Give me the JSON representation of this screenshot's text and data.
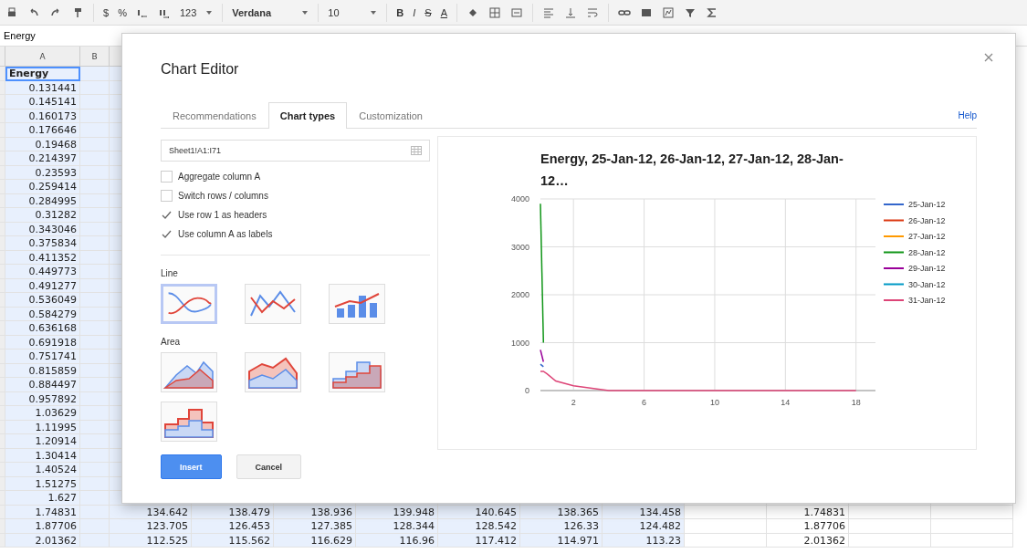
{
  "toolbar": {
    "currency": "$",
    "percent": "%",
    "number_format": "123",
    "font": "Verdana",
    "font_size": "10",
    "bold": "B",
    "italic": "I",
    "strikethrough": "S",
    "text_color": "A"
  },
  "formula_bar": {
    "value": "Energy"
  },
  "sheet": {
    "columns": [
      "A",
      "B"
    ],
    "rows": [
      {
        "column_a": "Energy",
        "selected": true
      },
      {
        "column_a": "0.131441",
        "selected": false
      },
      {
        "column_a": "0.145141",
        "selected": false
      },
      {
        "column_a": "0.160173",
        "selected": false
      },
      {
        "column_a": "0.176646",
        "selected": false
      },
      {
        "column_a": "0.19468",
        "selected": false
      },
      {
        "column_a": "0.214397",
        "selected": false
      },
      {
        "column_a": "0.23593",
        "selected": false
      },
      {
        "column_a": "0.259414",
        "selected": false
      },
      {
        "column_a": "0.284995",
        "selected": false
      },
      {
        "column_a": "0.31282",
        "selected": false
      },
      {
        "column_a": "0.343046",
        "selected": false
      },
      {
        "column_a": "0.375834",
        "selected": false
      },
      {
        "column_a": "0.411352",
        "selected": false
      },
      {
        "column_a": "0.449773",
        "selected": false
      },
      {
        "column_a": "0.491277",
        "selected": false
      },
      {
        "column_a": "0.536049",
        "selected": false
      },
      {
        "column_a": "0.584279",
        "selected": false
      },
      {
        "column_a": "0.636168",
        "selected": false
      },
      {
        "column_a": "0.691918",
        "selected": false
      },
      {
        "column_a": "0.751741",
        "selected": false
      },
      {
        "column_a": "0.815859",
        "selected": false
      },
      {
        "column_a": "0.884497",
        "selected": false
      },
      {
        "column_a": "0.957892",
        "selected": false
      },
      {
        "column_a": "1.03629",
        "selected": false
      },
      {
        "column_a": "1.11995",
        "selected": false
      },
      {
        "column_a": "1.20914",
        "selected": false
      },
      {
        "column_a": "1.30414",
        "selected": false
      },
      {
        "column_a": "1.40524",
        "selected": false
      },
      {
        "column_a": "1.51275",
        "selected": false
      },
      {
        "column_a": "1.627",
        "selected": false
      },
      {
        "column_a": "1.74831",
        "selected": false,
        "columns_c_to_i": [
          "134.642",
          "138.479",
          "138.936",
          "139.948",
          "140.645",
          "138.365",
          "134.458"
        ],
        "column_k": "1.74831"
      },
      {
        "column_a": "1.87706",
        "selected": false,
        "columns_c_to_i": [
          "123.705",
          "126.453",
          "127.385",
          "128.344",
          "128.542",
          "126.33",
          "124.482"
        ],
        "column_k": "1.87706"
      },
      {
        "column_a": "2.01362",
        "selected": false,
        "columns_c_to_i": [
          "112.525",
          "115.562",
          "116.629",
          "116.96",
          "117.412",
          "114.971",
          "113.23"
        ],
        "column_k": "2.01362"
      }
    ]
  },
  "dialog": {
    "title": "Chart Editor",
    "tabs": [
      {
        "label": "Recommendations",
        "selected": false
      },
      {
        "label": "Chart types",
        "selected": true
      },
      {
        "label": "Customization",
        "selected": false
      }
    ],
    "help": "Help",
    "range": "Sheet1!A1:I71",
    "options": [
      {
        "label": "Aggregate column A",
        "checked": false
      },
      {
        "label": "Switch rows / columns",
        "checked": false
      },
      {
        "label": "Use row 1 as headers",
        "checked": true
      },
      {
        "label": "Use column A as labels",
        "checked": true
      }
    ],
    "groups": [
      {
        "label": "Line",
        "types": [
          {
            "kind": "curves",
            "selected": true
          },
          {
            "kind": "lines",
            "selected": false
          },
          {
            "kind": "combo",
            "selected": false
          }
        ]
      },
      {
        "label": "Area",
        "types": [
          {
            "kind": "area",
            "selected": false
          },
          {
            "kind": "area_overlap",
            "selected": false
          },
          {
            "kind": "stepped",
            "selected": false
          },
          {
            "kind": "stepped_overlap",
            "selected": false
          }
        ]
      }
    ],
    "buttons": [
      {
        "label": "Insert",
        "kind": "primary"
      },
      {
        "label": "Cancel",
        "kind": "secondary"
      }
    ],
    "preview": {
      "chart_data": {
        "type": "line",
        "title": "Energy, 25-Jan-12, 26-Jan-12, 27-Jan-12, 28-Jan-12…",
        "x": [
          0.13,
          0.3,
          0.5,
          1,
          2,
          4,
          6,
          10,
          18
        ],
        "series": [
          {
            "name": "25-Jan-12",
            "color": "#3366cc",
            "values": [
              550,
              500,
              null,
              null,
              null,
              null,
              null,
              null,
              null
            ]
          },
          {
            "name": "26-Jan-12",
            "color": "#dc3912",
            "values": [
              null,
              null,
              null,
              null,
              null,
              null,
              null,
              null,
              null
            ]
          },
          {
            "name": "27-Jan-12",
            "color": "#ff9900",
            "values": [
              null,
              null,
              null,
              null,
              null,
              null,
              null,
              null,
              null
            ]
          },
          {
            "name": "28-Jan-12",
            "color": "#109618",
            "values": [
              3900,
              1000,
              null,
              null,
              null,
              null,
              null,
              null,
              null
            ]
          },
          {
            "name": "29-Jan-12",
            "color": "#990099",
            "values": [
              850,
              600,
              null,
              null,
              null,
              null,
              null,
              null,
              null
            ]
          },
          {
            "name": "30-Jan-12",
            "color": "#0099c6",
            "values": [
              null,
              null,
              null,
              null,
              null,
              null,
              null,
              null,
              null
            ]
          },
          {
            "name": "31-Jan-12",
            "color": "#dd4477",
            "values": [
              400,
              400,
              350,
              200,
              100,
              0,
              0,
              0,
              0
            ]
          }
        ],
        "xlim": [
          0.13,
          19.1
        ],
        "ylim": [
          0,
          4000
        ],
        "xticks": [
          2,
          6,
          10,
          14,
          18
        ],
        "yticks": [
          0,
          1000,
          2000,
          3000,
          4000
        ],
        "grid": true,
        "legend": "right"
      }
    }
  }
}
